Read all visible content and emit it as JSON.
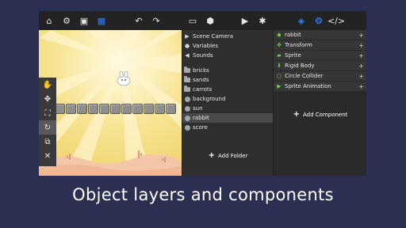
{
  "toolbar": {
    "left": [
      {
        "icon": "home-icon",
        "glyph": "⌂"
      },
      {
        "icon": "gear-icon",
        "glyph": "⚙"
      },
      {
        "icon": "save-icon",
        "glyph": "▣"
      },
      {
        "icon": "grid-icon",
        "glyph": "▦"
      }
    ],
    "mid": [
      {
        "icon": "undo-icon",
        "glyph": "↶"
      },
      {
        "icon": "redo-icon",
        "glyph": "↷"
      }
    ],
    "right1": [
      {
        "icon": "monitor-icon",
        "glyph": "▭"
      },
      {
        "icon": "cube-icon",
        "glyph": "⬢"
      }
    ],
    "right2": [
      {
        "icon": "play-icon",
        "glyph": "▶"
      },
      {
        "icon": "bug-icon",
        "glyph": "✱"
      }
    ],
    "right3": [
      {
        "icon": "layers-icon",
        "glyph": "◈"
      },
      {
        "icon": "components-icon",
        "glyph": "❂"
      },
      {
        "icon": "code-icon",
        "glyph": "</>"
      }
    ]
  },
  "side_tools": [
    {
      "icon": "hand-icon",
      "glyph": "✋"
    },
    {
      "icon": "move-icon",
      "glyph": "✥"
    },
    {
      "icon": "scale-icon",
      "glyph": "⛶"
    },
    {
      "icon": "rotate-icon",
      "glyph": "↻"
    },
    {
      "icon": "copy-icon",
      "glyph": "⧉"
    },
    {
      "icon": "delete-icon",
      "glyph": "✕"
    }
  ],
  "hierarchy": {
    "top_items": [
      {
        "label": "Scene Camera",
        "icon": "camera-icon",
        "glyph": "▶"
      },
      {
        "label": "Variables",
        "icon": "variables-icon",
        "glyph": "●"
      },
      {
        "label": "Sounds",
        "icon": "sound-icon",
        "glyph": "◀"
      }
    ],
    "folders": [
      {
        "label": "bricks"
      },
      {
        "label": "sands"
      },
      {
        "label": "carrots"
      }
    ],
    "objects": [
      {
        "label": "background"
      },
      {
        "label": "sun"
      },
      {
        "label": "rabbit"
      },
      {
        "label": "score"
      }
    ],
    "add_folder_label": "Add Folder"
  },
  "inspector": {
    "components": [
      {
        "label": "rabbit",
        "icon": "object-icon",
        "glyph": "◆"
      },
      {
        "label": "Transform",
        "icon": "transform-icon",
        "glyph": "✥"
      },
      {
        "label": "Sprite",
        "icon": "sprite-icon",
        "glyph": "▰"
      },
      {
        "label": "Rigid Body",
        "icon": "rigidbody-icon",
        "glyph": "⬇"
      },
      {
        "label": "Circle Collider",
        "icon": "collider-icon",
        "glyph": "○"
      },
      {
        "label": "Sprite Animation",
        "icon": "animation-icon",
        "glyph": "▶"
      }
    ],
    "add_component_label": "Add Component"
  },
  "caption": "Object layers and components"
}
